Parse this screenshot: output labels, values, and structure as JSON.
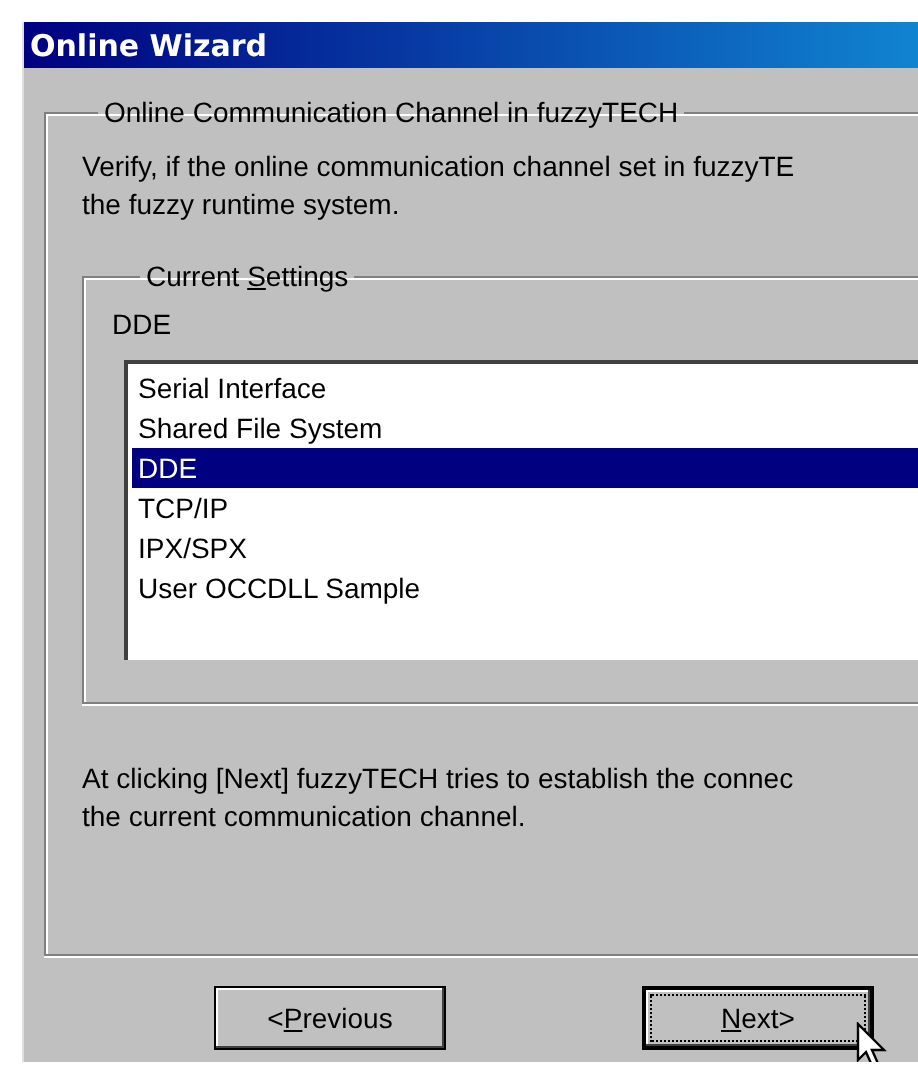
{
  "window": {
    "title": "Online Wizard"
  },
  "group": {
    "title": "Online Communication Channel in fuzzyTECH",
    "intro": [
      "Verify, if the online communication channel set in fuzzyTE",
      "the fuzzy runtime system."
    ]
  },
  "settings": {
    "title": {
      "before": "Current ",
      "key": "S",
      "after": "ettings"
    },
    "current": "DDE",
    "channels": [
      {
        "label": "Serial Interface",
        "selected": false
      },
      {
        "label": "Shared File System",
        "selected": false
      },
      {
        "label": "DDE",
        "selected": true
      },
      {
        "label": "TCP/IP",
        "selected": false
      },
      {
        "label": "IPX/SPX",
        "selected": false
      },
      {
        "label": "User OCCDLL Sample",
        "selected": false
      }
    ]
  },
  "footer": [
    "At clicking [Next] fuzzyTECH tries to establish the connec",
    "the current communication channel."
  ],
  "buttons": [
    {
      "before": "<",
      "key": "P",
      "after": "revious",
      "focused": false
    },
    {
      "key": "N",
      "after": "ext>",
      "focused": true
    }
  ]
}
